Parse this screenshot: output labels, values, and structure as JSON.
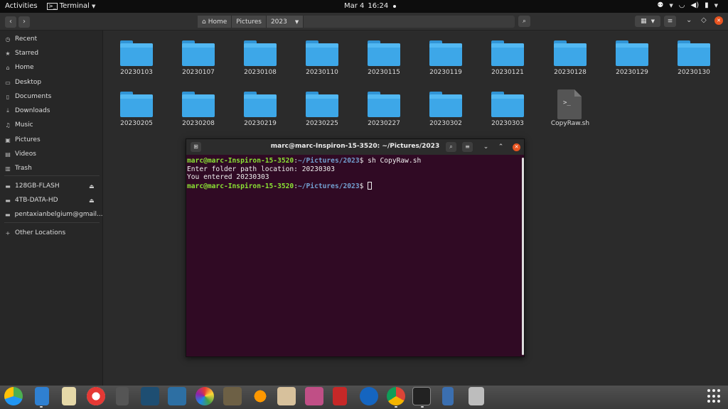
{
  "topbar": {
    "activities": "Activities",
    "app_name": "Terminal",
    "clock_date": "Mar 4",
    "clock_time": "16:24"
  },
  "header": {
    "path": [
      {
        "label": "Home",
        "icon": "home-icon"
      },
      {
        "label": "Pictures"
      },
      {
        "label": "2023"
      }
    ]
  },
  "sidebar": {
    "items": [
      {
        "label": "Recent",
        "icon": "clock-icon"
      },
      {
        "label": "Starred",
        "icon": "star-icon"
      },
      {
        "label": "Home",
        "icon": "home-icon"
      },
      {
        "label": "Desktop",
        "icon": "desktop-icon"
      },
      {
        "label": "Documents",
        "icon": "document-icon"
      },
      {
        "label": "Downloads",
        "icon": "download-icon"
      },
      {
        "label": "Music",
        "icon": "music-icon"
      },
      {
        "label": "Pictures",
        "icon": "picture-icon"
      },
      {
        "label": "Videos",
        "icon": "video-icon"
      },
      {
        "label": "Trash",
        "icon": "trash-icon"
      }
    ],
    "devices": [
      {
        "label": "128GB-FLASH",
        "icon": "drive-icon"
      },
      {
        "label": "4TB-DATA-HD",
        "icon": "drive-icon"
      },
      {
        "label": "pentaxianbelgium@gmail....",
        "icon": "cloud-icon"
      }
    ],
    "other": {
      "label": "Other Locations",
      "icon": "plus-icon"
    }
  },
  "files": [
    "20230103",
    "20230107",
    "20230108",
    "20230110",
    "20230115",
    "20230119",
    "20230121",
    "20230128",
    "20230129",
    "20230130",
    "20230205",
    "20230208",
    "20230219",
    "20230225",
    "20230227",
    "20230302",
    "20230303"
  ],
  "script_file": "CopyRaw.sh",
  "terminal": {
    "title": "marc@marc-Inspiron-15-3520: ~/Pictures/2023",
    "prompt_user": "marc@marc-Inspiron-15-3520",
    "prompt_path": "~/Pictures/2023",
    "command": " sh CopyRaw.sh",
    "line2": "Enter folder path location: 20230303",
    "line3": "You entered 20230303"
  },
  "colors": {
    "accent": "#e95420",
    "folder": "#3da7e8",
    "terminal_bg": "#300a24",
    "prompt_user": "#8ae234",
    "prompt_path": "#729fcf"
  },
  "dock_icons": [
    "files-icon",
    "notes-icon",
    "disk-icon",
    "lifebuoy-icon",
    "blank-icon",
    "book-icon",
    "linux-icon",
    "color-wheel-icon",
    "gimp-icon",
    "sound-icon",
    "photos-icon",
    "screenshot-icon",
    "archive-icon",
    "thunderbird-icon",
    "chrome-icon",
    "terminal-icon",
    "usb-icon",
    "drive-icon"
  ]
}
